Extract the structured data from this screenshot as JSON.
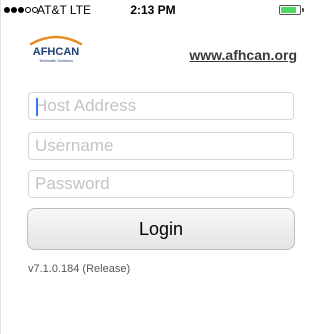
{
  "status_bar": {
    "carrier": "AT&T  LTE",
    "time": "2:13 PM",
    "signal_bars_filled": 3,
    "signal_bars_total": 5,
    "battery_level": 0.85,
    "battery_color": "#4cd964"
  },
  "header": {
    "logo_text": "AFHCAN",
    "logo_tagline": "Telehealth Solutions",
    "site_link": "www.afhcan.org"
  },
  "form": {
    "host_placeholder": "Host Address",
    "username_placeholder": "Username",
    "password_placeholder": "Password",
    "login_label": "Login"
  },
  "footer": {
    "version": "v7.1.0.184 (Release)"
  },
  "colors": {
    "caret": "#3478f6",
    "placeholder": "#c3c3c3",
    "logo_orange": "#e98a1e",
    "logo_navy": "#1e3f73"
  }
}
